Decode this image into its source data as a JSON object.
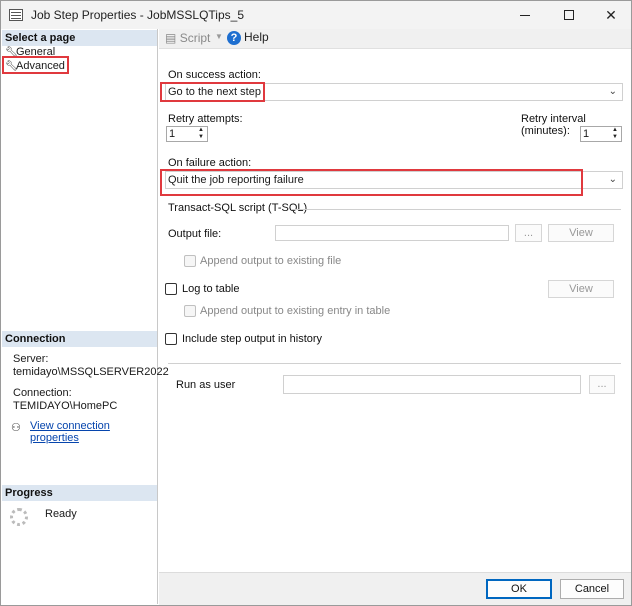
{
  "window": {
    "title": "Job Step Properties - JobMSSLQTips_5",
    "minimize": "—",
    "maximize": "",
    "close": "✕"
  },
  "left_panel": {
    "select_page_header": "Select a page",
    "pages": [
      {
        "label": "General"
      },
      {
        "label": "Advanced",
        "highlighted": true
      }
    ],
    "connection": {
      "header": "Connection",
      "server_label": "Server:",
      "server_value": "temidayo\\MSSQLSERVER2022",
      "connection_label": "Connection:",
      "connection_value": "TEMIDAYO\\HomePC",
      "view_link": "View connection properties"
    },
    "progress": {
      "header": "Progress",
      "status": "Ready"
    }
  },
  "toolbar": {
    "script_label": "Script",
    "help_label": "Help"
  },
  "form": {
    "on_success_label": "On success action:",
    "on_success_value": "Go to the next step",
    "retry_attempts_label": "Retry attempts:",
    "retry_attempts_value": "1",
    "retry_interval_label": "Retry interval (minutes):",
    "retry_interval_value": "1",
    "on_failure_label": "On failure action:",
    "on_failure_value": "Quit the job reporting failure",
    "tsql_group": "Transact-SQL script (T-SQL)",
    "output_file_label": "Output file:",
    "output_file_value": "",
    "browse_label": "...",
    "view_label": "View",
    "append_output_label": "Append output to existing file",
    "log_to_table_label": "Log to table",
    "view2_label": "View",
    "append_table_label": "Append output to existing entry in table",
    "include_history_label": "Include step output in history",
    "run_as_user_label": "Run as user",
    "run_as_user_value": "",
    "browse2_label": "..."
  },
  "buttons": {
    "ok": "OK",
    "cancel": "Cancel"
  },
  "colors": {
    "highlight_red": "#e0393e",
    "section_header_bg": "#dce6f1",
    "link": "#0645ad"
  }
}
